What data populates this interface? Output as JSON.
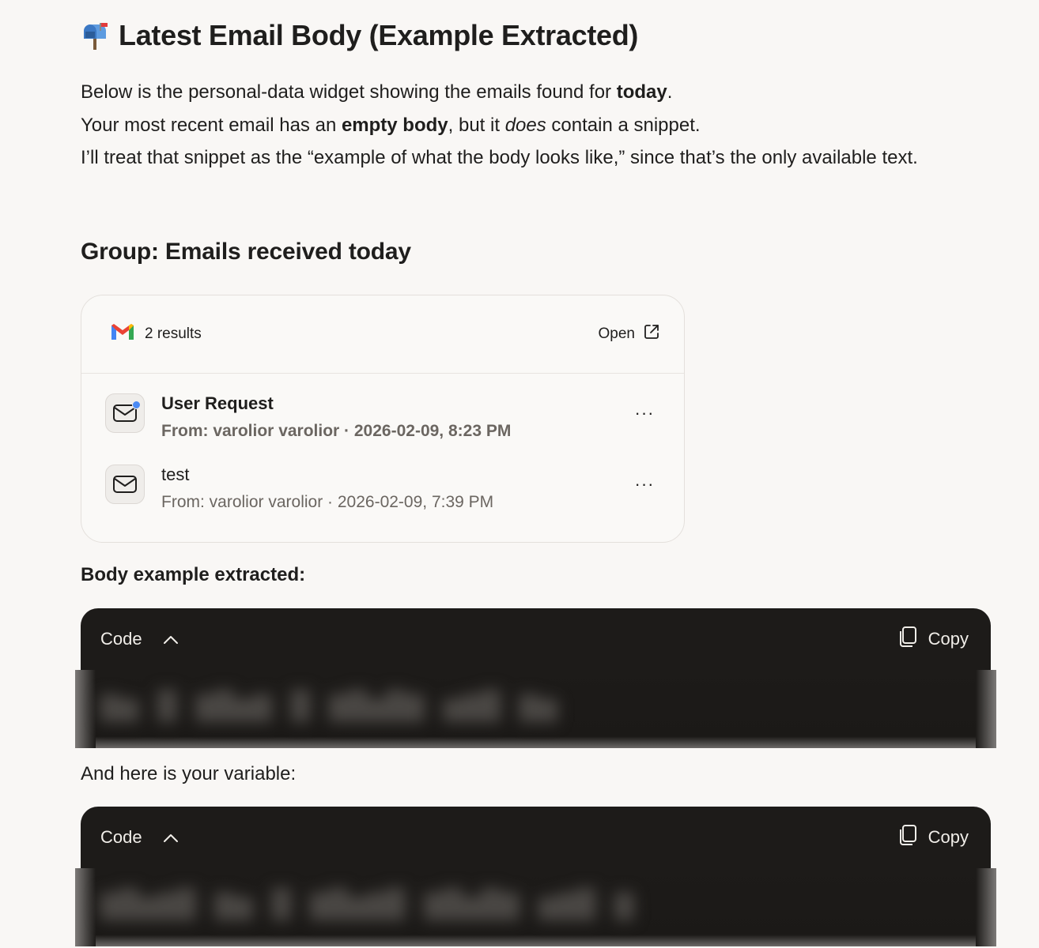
{
  "title": {
    "emoji": "📬",
    "text": "Latest Email Body (Example Extracted)"
  },
  "intro": {
    "line1_pre": "Below is the personal-data widget showing the emails found for ",
    "line1_bold": "today",
    "line1_post": ".",
    "line2_pre": "Your most recent email has an ",
    "line2_bold": "empty body",
    "line2_mid": ", but it ",
    "line2_italic": "does",
    "line2_post": " contain a snippet.",
    "line3": "I’ll treat that snippet as the “example of what the body looks like,” since that’s the only available text."
  },
  "group_heading": "Group: Emails received today",
  "widget": {
    "results_label": "2 results",
    "open_label": "Open",
    "emails": [
      {
        "subject": "User Request",
        "meta": "From: varolior varolior · 2026-02-09, 8:23 PM",
        "unread": true
      },
      {
        "subject": "test",
        "meta": "From: varolior varolior · 2026-02-09, 7:39 PM",
        "unread": false
      }
    ],
    "more_label": "···"
  },
  "body_label": "Body example extracted:",
  "variable_label": "And here is your variable:",
  "code_blocks": [
    {
      "toggle_label": "Code",
      "copy_label": "Copy"
    },
    {
      "toggle_label": "Code",
      "copy_label": "Copy"
    }
  ],
  "colors": {
    "background": "#f9f7f5",
    "code_background": "#1d1b19",
    "unread_dot": "#4a8af4",
    "gmail_red": "#ea4335",
    "gmail_blue": "#4285f4",
    "gmail_green": "#34a853",
    "gmail_yellow": "#fbbc04"
  }
}
